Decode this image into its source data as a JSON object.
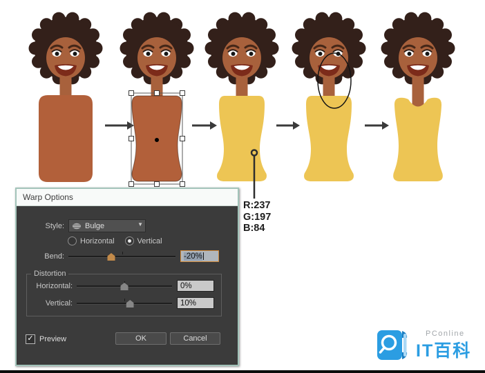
{
  "colors": {
    "skin": "#a8613c",
    "torso": "#b2603a",
    "hair": "#33201a",
    "shirt_yellow": "#edc554",
    "dialog_border": "#a3c4ba",
    "accent_orange": "#cf8a3b",
    "logo_blue": "#2b9de2"
  },
  "dialog": {
    "title": "Warp Options",
    "style": {
      "label": "Style:",
      "value": "Bulge"
    },
    "orientation": {
      "horizontal_label": "Horizontal",
      "vertical_label": "Vertical",
      "selected": "Vertical"
    },
    "bend": {
      "label": "Bend:",
      "value": "-20%"
    },
    "distortion": {
      "group_label": "Distortion",
      "horizontal": {
        "label": "Horizontal:",
        "value": "0%"
      },
      "vertical": {
        "label": "Vertical:",
        "value": "10%"
      }
    },
    "preview": {
      "label": "Preview",
      "checked": true
    },
    "buttons": {
      "ok": "OK",
      "cancel": "Cancel"
    }
  },
  "color_callout": {
    "line1": "R:237",
    "line2": "G:197",
    "line3": "B:84"
  },
  "watermark": {
    "brand": "PConline",
    "title": "IT百科"
  }
}
